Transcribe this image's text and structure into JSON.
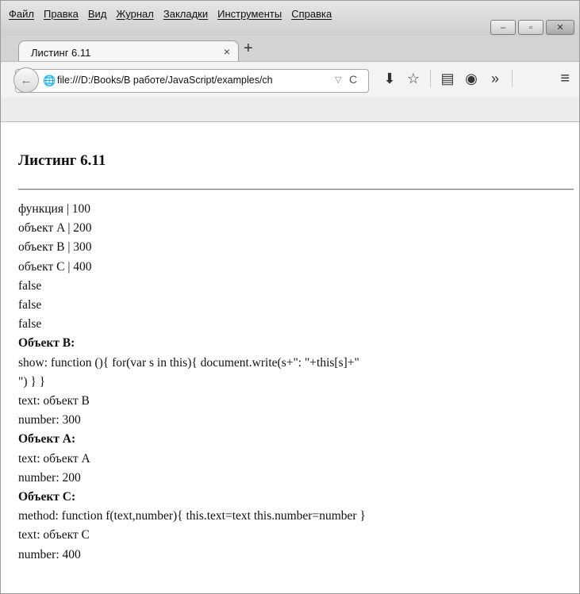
{
  "menu": [
    "Файл",
    "Правка",
    "Вид",
    "Журнал",
    "Закладки",
    "Инструменты",
    "Справка"
  ],
  "window_controls": {
    "minimize": "–",
    "maximize": "▫",
    "close": "✕"
  },
  "tab": {
    "title": "Листинг 6.11",
    "close": "×",
    "new_tab": "+"
  },
  "address": {
    "url": "file:///D:/Books/В работе/JavaScript/examples/ch",
    "dropdown": "▽",
    "reload": "C"
  },
  "nav_icons": [
    {
      "name": "download-icon",
      "glyph": "⬇"
    },
    {
      "name": "bookmark-star-icon",
      "glyph": "☆"
    },
    {
      "name": "reading-list-icon",
      "glyph": "▤"
    },
    {
      "name": "pocket-icon",
      "glyph": "◉"
    },
    {
      "name": "overflow-icon",
      "glyph": "»"
    }
  ],
  "menu_icon": "≡",
  "page": {
    "title": "Листинг 6.11",
    "lines": [
      {
        "text": "функция | 100",
        "bold": false
      },
      {
        "text": "объект A | 200",
        "bold": false
      },
      {
        "text": "объект B | 300",
        "bold": false
      },
      {
        "text": "объект C | 400",
        "bold": false
      },
      {
        "text": "false",
        "bold": false
      },
      {
        "text": "false",
        "bold": false
      },
      {
        "text": "false",
        "bold": false
      },
      {
        "text": "Объект B:",
        "bold": true
      },
      {
        "text": "show: function (){ for(var s in this){ document.write(s+\": \"+this[s]+\"",
        "bold": false
      },
      {
        "text": "\") } }",
        "bold": false
      },
      {
        "text": "text: объект B",
        "bold": false
      },
      {
        "text": "number: 300",
        "bold": false
      },
      {
        "text": "Объект A:",
        "bold": true
      },
      {
        "text": "text: объект A",
        "bold": false
      },
      {
        "text": "number: 200",
        "bold": false
      },
      {
        "text": "Объект C:",
        "bold": true
      },
      {
        "text": "method: function f(text,number){ this.text=text this.number=number }",
        "bold": false
      },
      {
        "text": "text: объект C",
        "bold": false
      },
      {
        "text": "number: 400",
        "bold": false
      }
    ]
  }
}
